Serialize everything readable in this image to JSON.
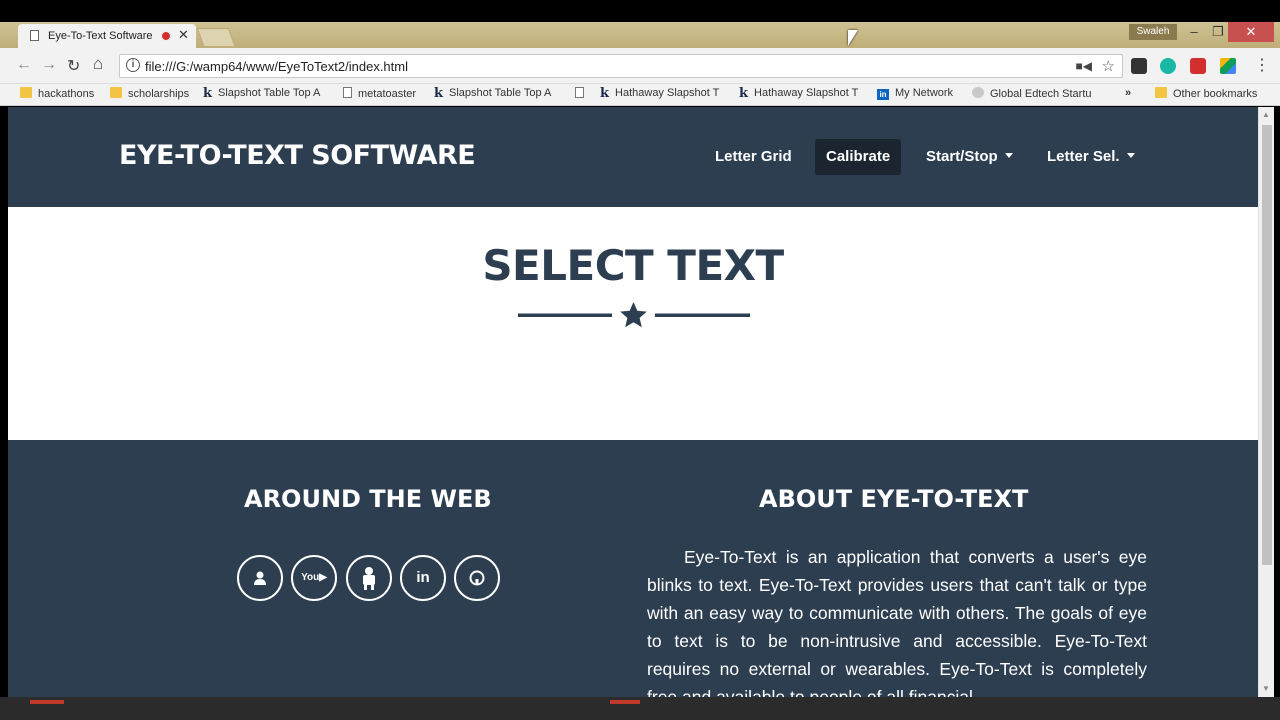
{
  "browser": {
    "tab_title": "Eye-To-Text Software",
    "tab_close": "✕",
    "user": "Swaleh",
    "url": "file:///G:/wamp64/www/EyeToText2/index.html",
    "bookmarks": [
      {
        "label": "hackathons",
        "icon": "folder"
      },
      {
        "label": "scholarships",
        "icon": "folder"
      },
      {
        "label": "Slapshot Table Top A",
        "icon": "k"
      },
      {
        "label": "metatoaster",
        "icon": "page"
      },
      {
        "label": "Slapshot Table Top A",
        "icon": "k"
      },
      {
        "label": "Hathaway Slapshot T",
        "icon": "k"
      },
      {
        "label": "Hathaway Slapshot T",
        "icon": "k"
      },
      {
        "label": "My Network",
        "icon": "linkedin"
      },
      {
        "label": "Global Edtech Startu",
        "icon": "globe"
      }
    ],
    "overflow": "»",
    "other_bookmarks": "Other bookmarks"
  },
  "page": {
    "brand": "EYE-TO-TEXT SOFTWARE",
    "nav": [
      {
        "label": "Letter Grid"
      },
      {
        "label": "Calibrate"
      },
      {
        "label": "Start/Stop"
      },
      {
        "label": "Letter Sel."
      }
    ],
    "section_title": "SELECT TEXT",
    "footer": {
      "web_heading": "AROUND THE WEB",
      "about_heading": "ABOUT EYE-TO-TEXT",
      "social_icons": [
        "user-icon",
        "youtube-icon",
        "devpost-icon",
        "linkedin-icon",
        "github-icon"
      ],
      "about_text": "Eye-To-Text is an application that converts a user's eye blinks to text. Eye-To-Text provides users that can't talk or type with an easy way to communicate with others. The goals of eye to text is to be non-intrusive and accessible. Eye-To-Text requires no external or wearables. Eye-To-Text is completely free and available to people of all financial"
    }
  },
  "colors": {
    "primary": "#2c3e50",
    "active_nav": "#1a252f",
    "chrome_frame": "#c8b887"
  }
}
